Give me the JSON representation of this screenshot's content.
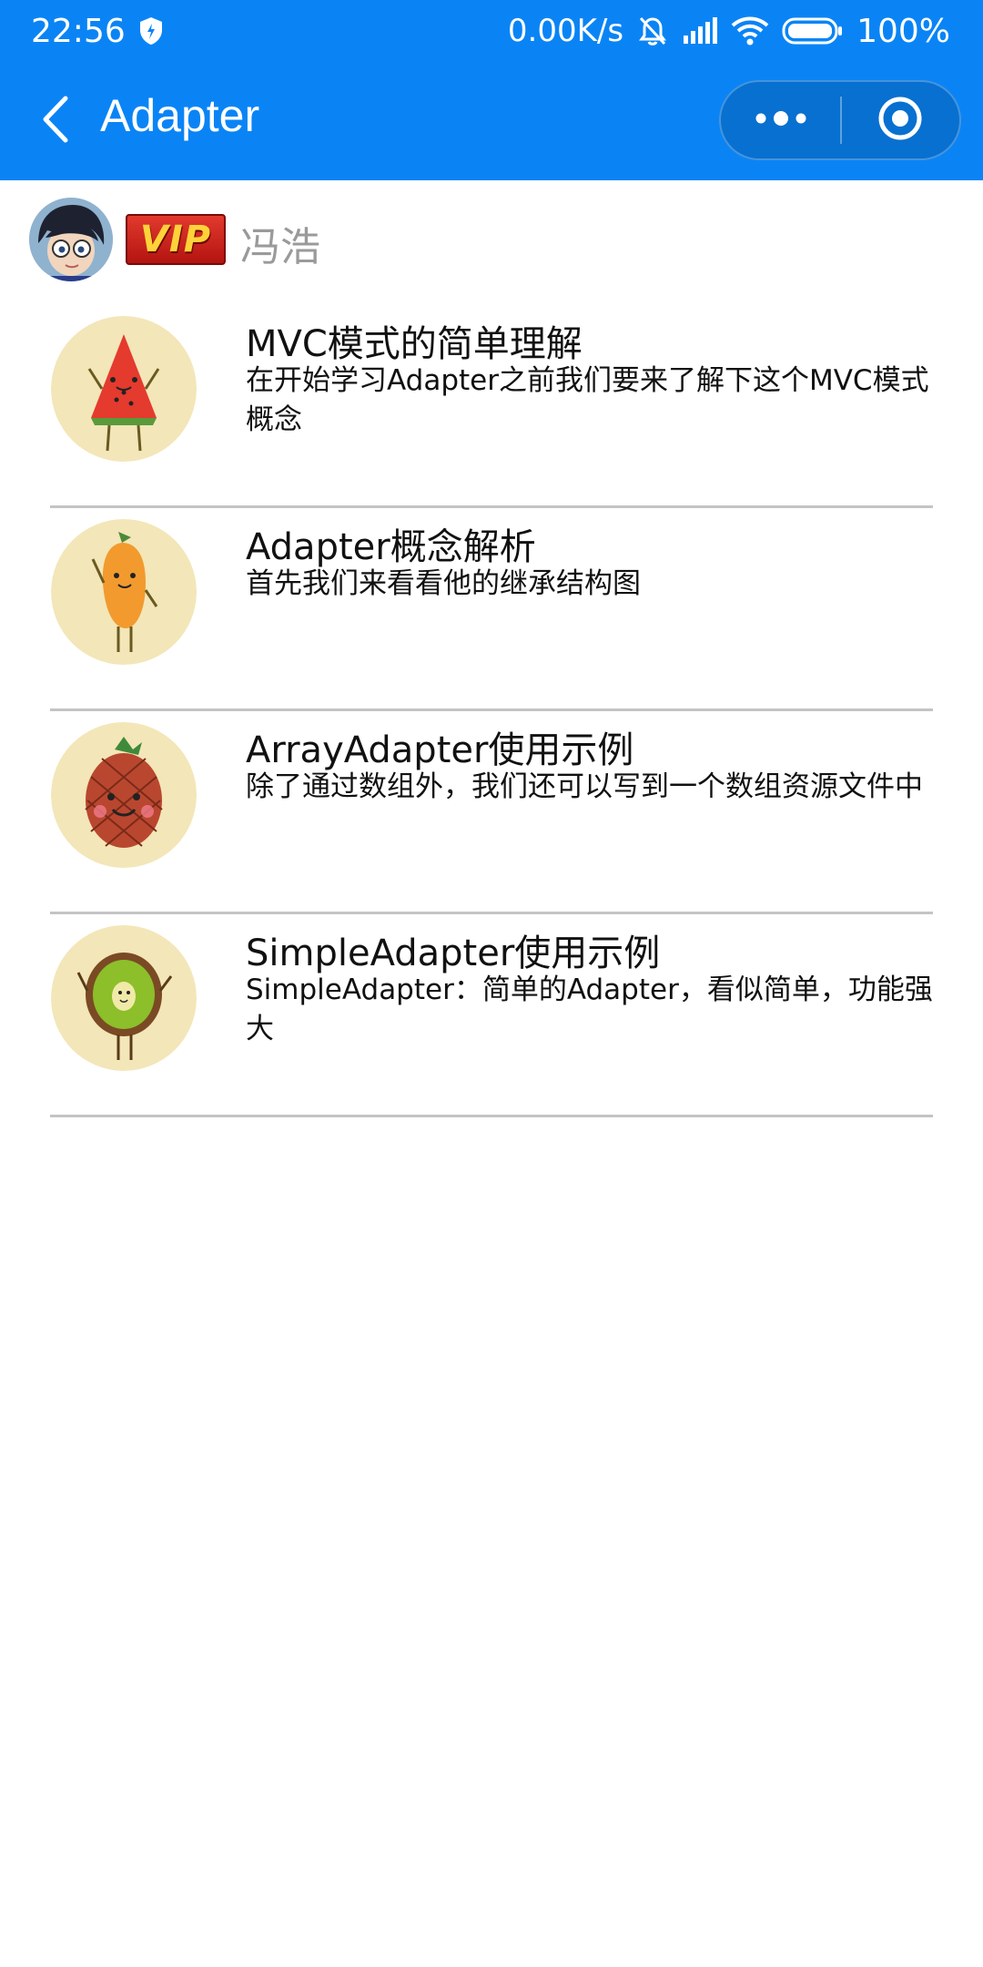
{
  "status_bar": {
    "time": "22:56",
    "network_speed": "0.00K/s",
    "battery": "100%",
    "icons": [
      "shield-icon",
      "mute-bell-icon",
      "signal-icon",
      "wifi-icon",
      "battery-icon"
    ]
  },
  "app_bar": {
    "title": "Adapter",
    "icons": [
      "back-arrow-icon",
      "more-dots-icon",
      "close-target-icon"
    ]
  },
  "profile": {
    "badge": "VIP",
    "username": "冯浩"
  },
  "list": [
    {
      "title": " MVC模式的简单理解",
      "desc": "在开始学习Adapter之前我们要来了解下这个MVC模式概念",
      "icon": "watermelon-icon"
    },
    {
      "title": "Adapter概念解析",
      "desc": "首先我们来看看他的继承结构图",
      "icon": "mango-icon"
    },
    {
      "title": "ArrayAdapter使用示例",
      "desc": "除了通过数组外，我们还可以写到一个数组资源文件中",
      "icon": "pineapple-icon"
    },
    {
      "title": "SimpleAdapter使用示例",
      "desc": "SimpleAdapter：简单的Adapter，看似简单，功能强大",
      "icon": "kiwi-icon"
    }
  ],
  "colors": {
    "primary": "#0a84f5",
    "thumb_bg": "#f3e6b8",
    "divider": "#c4c4c4",
    "username": "#9a9a9a"
  }
}
